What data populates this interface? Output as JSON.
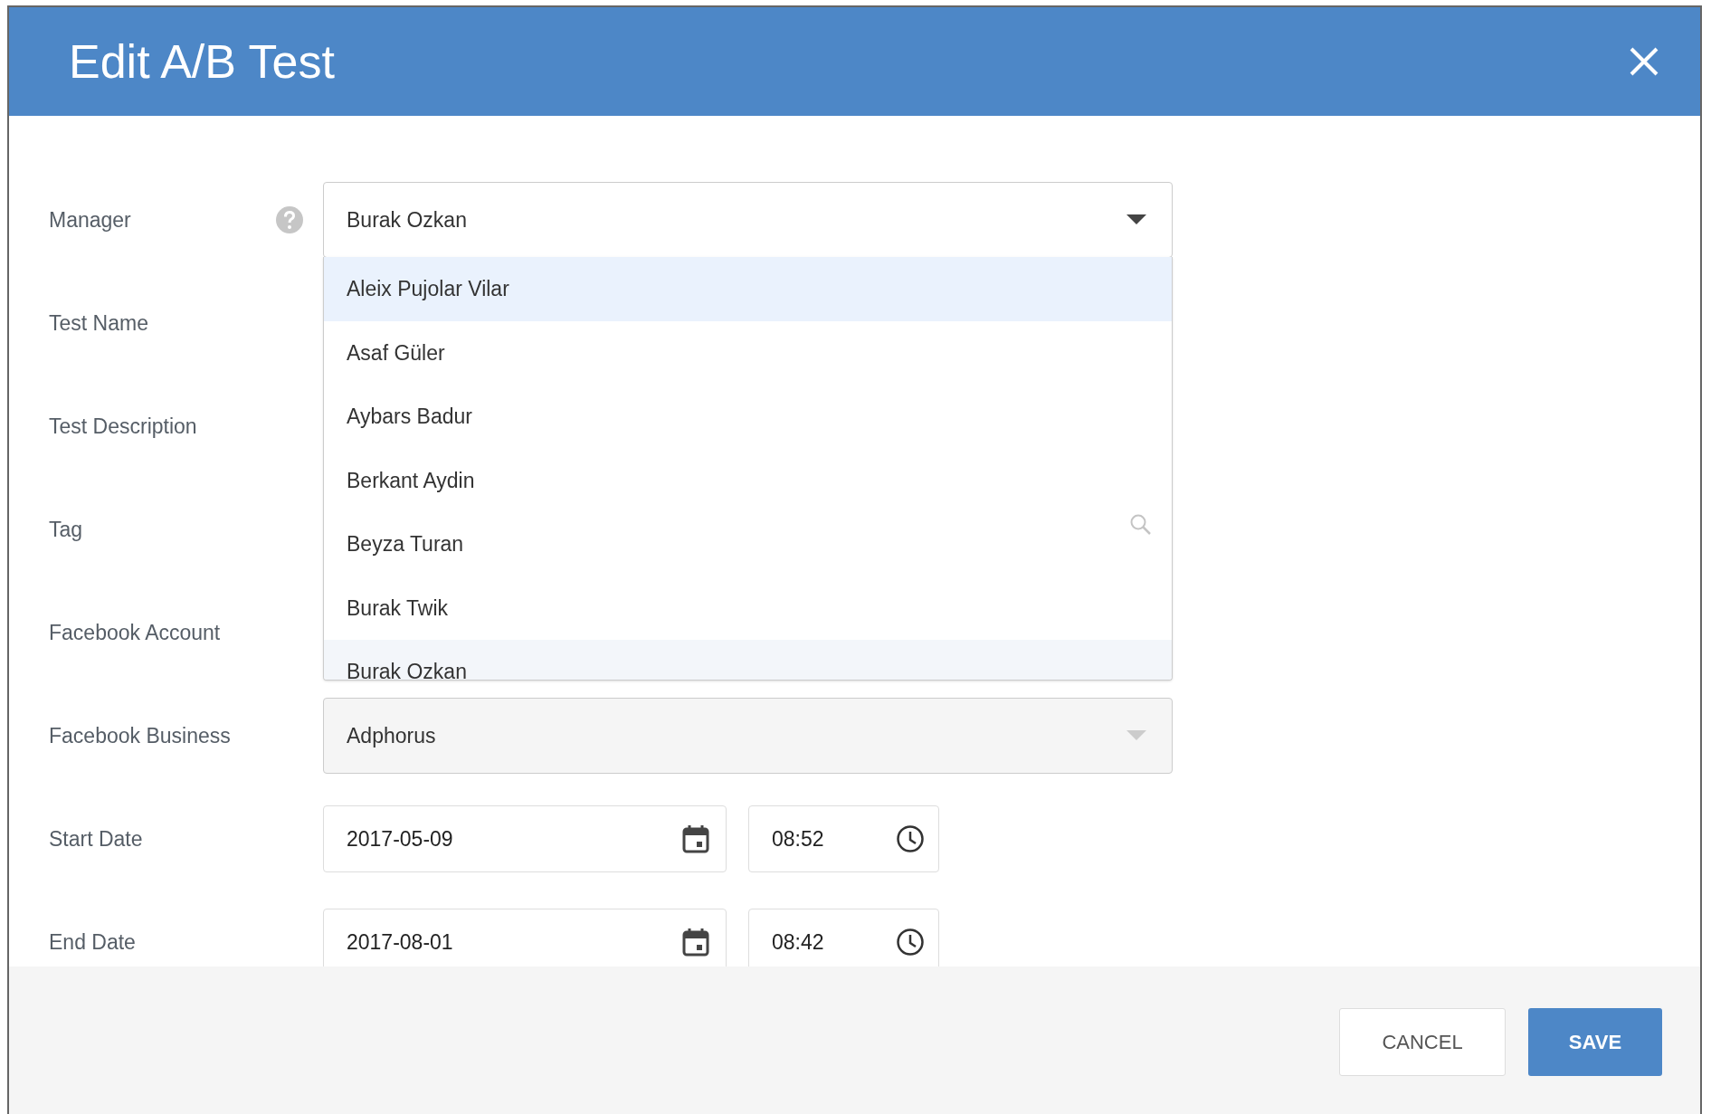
{
  "dialog": {
    "title": "Edit A/B Test"
  },
  "fields": [
    {
      "label": "Manager",
      "kind": "select",
      "help": true,
      "value": "Burak Ozkan",
      "disabled": false
    },
    {
      "label": "Test Name",
      "kind": "covered",
      "help": false
    },
    {
      "label": "Test Description",
      "kind": "covered",
      "help": false
    },
    {
      "label": "Tag",
      "kind": "covered",
      "help": false
    },
    {
      "label": "Facebook Account",
      "kind": "covered",
      "help": false
    },
    {
      "label": "Facebook Business",
      "kind": "select",
      "help": false,
      "value": "Adphorus",
      "disabled": true
    },
    {
      "label": "Start Date",
      "kind": "datetime",
      "help": false,
      "date": "2017-05-09",
      "time": "08:52"
    },
    {
      "label": "End Date",
      "kind": "datetime",
      "help": false,
      "date": "2017-08-01",
      "time": "08:42"
    }
  ],
  "dropdown": {
    "options": [
      {
        "label": "Aleix Pujolar Vilar",
        "highlighted": true,
        "selected": false
      },
      {
        "label": "Asaf Güler",
        "highlighted": false,
        "selected": false
      },
      {
        "label": "Aybars Badur",
        "highlighted": false,
        "selected": false
      },
      {
        "label": "Berkant Aydin",
        "highlighted": false,
        "selected": false
      },
      {
        "label": "Beyza Turan",
        "highlighted": false,
        "selected": false
      },
      {
        "label": "Burak Twik",
        "highlighted": false,
        "selected": false
      },
      {
        "label": "Burak Ozkan",
        "highlighted": false,
        "selected": true
      }
    ]
  },
  "buttons": [
    {
      "label": "CANCEL",
      "kind": "secondary"
    },
    {
      "label": "SAVE",
      "kind": "primary"
    }
  ]
}
